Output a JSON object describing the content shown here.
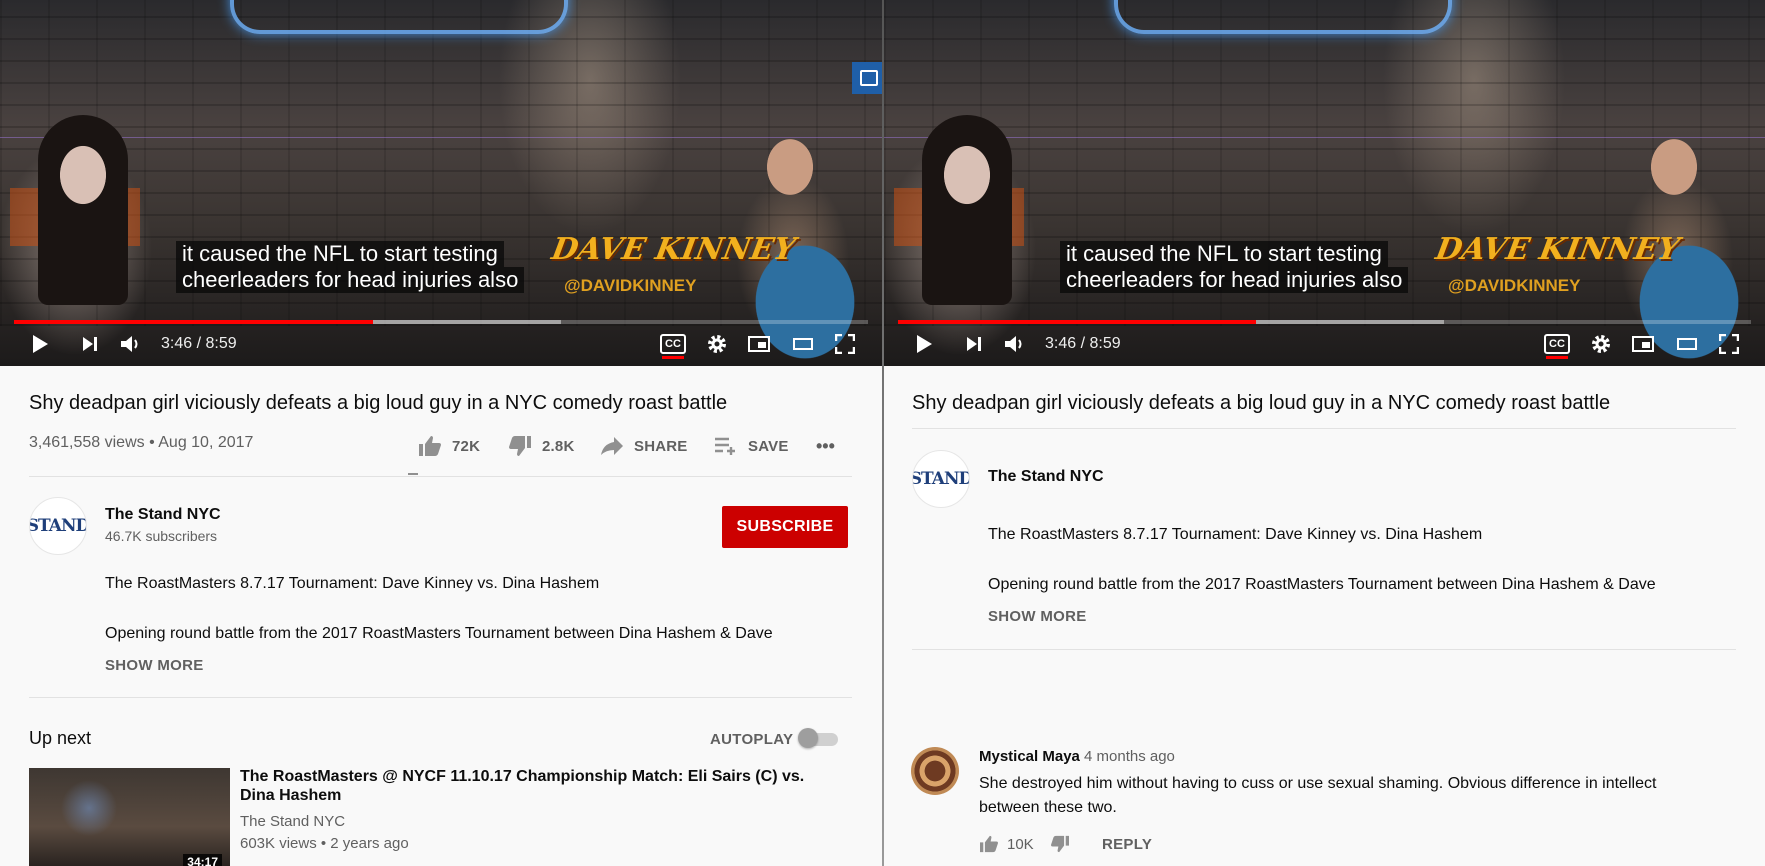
{
  "video": {
    "caption_line1": "it caused the NFL to start testing",
    "caption_line2": "cheerleaders for head injuries also",
    "time": "3:46 / 8:59",
    "progress_fraction": 0.42,
    "buffered_fraction": 0.64,
    "overlay_name": "DAVE KINNEY",
    "overlay_handle": "@DAVIDKINNEY",
    "cc_label": "CC",
    "icons": {
      "play": "play-icon",
      "next": "next-icon",
      "volume": "volume-icon",
      "cc": "cc-icon",
      "settings": "gear-icon",
      "miniplayer": "miniplayer-icon",
      "theater": "theater-icon",
      "fullscreen": "fullscreen-icon"
    }
  },
  "left": {
    "title": "Shy deadpan girl viciously defeats a big loud guy in a NYC comedy roast battle",
    "views_date": "3,461,558 views • Aug 10, 2017",
    "likes": "72K",
    "dislikes": "2.8K",
    "share_label": "SHARE",
    "save_label": "SAVE",
    "more_icon": "•••",
    "channel_name": "The Stand NYC",
    "subscribers": "46.7K subscribers",
    "subscribe_label": "SUBSCRIBE",
    "avatar_text": "STAND",
    "desc_line1": "The RoastMasters 8.7.17 Tournament: Dave Kinney vs. Dina Hashem",
    "desc_line2": "Opening round battle from the 2017 RoastMasters Tournament between Dina Hashem & Dave",
    "show_more": "SHOW MORE",
    "up_next": "Up next",
    "autoplay_label": "AUTOPLAY",
    "autoplay_on": false,
    "recommended": {
      "title": "The RoastMasters @ NYCF 11.10.17 Championship Match: Eli Sairs (C) vs. Dina Hashem",
      "channel": "The Stand NYC",
      "meta": "603K views • 2 years ago",
      "duration": "34:17"
    }
  },
  "right": {
    "title": "Shy deadpan girl viciously defeats a big loud guy in a NYC comedy roast battle",
    "channel_name": "The Stand NYC",
    "avatar_text": "STAND",
    "desc_line1": "The RoastMasters 8.7.17 Tournament: Dave Kinney vs. Dina Hashem",
    "desc_line2": "Opening round battle from the 2017 RoastMasters Tournament between Dina Hashem & Dave",
    "show_more": "SHOW MORE",
    "comment": {
      "author": "Mystical Maya",
      "time": "4 months ago",
      "text": "She destroyed him without having to cuss or use sexual shaming. Obvious difference in intellect between these two.",
      "likes": "10K",
      "reply_label": "REPLY"
    }
  },
  "colors": {
    "subscribe": "#cc0000",
    "progress": "#ff0000",
    "background": "#f9f9f9"
  }
}
